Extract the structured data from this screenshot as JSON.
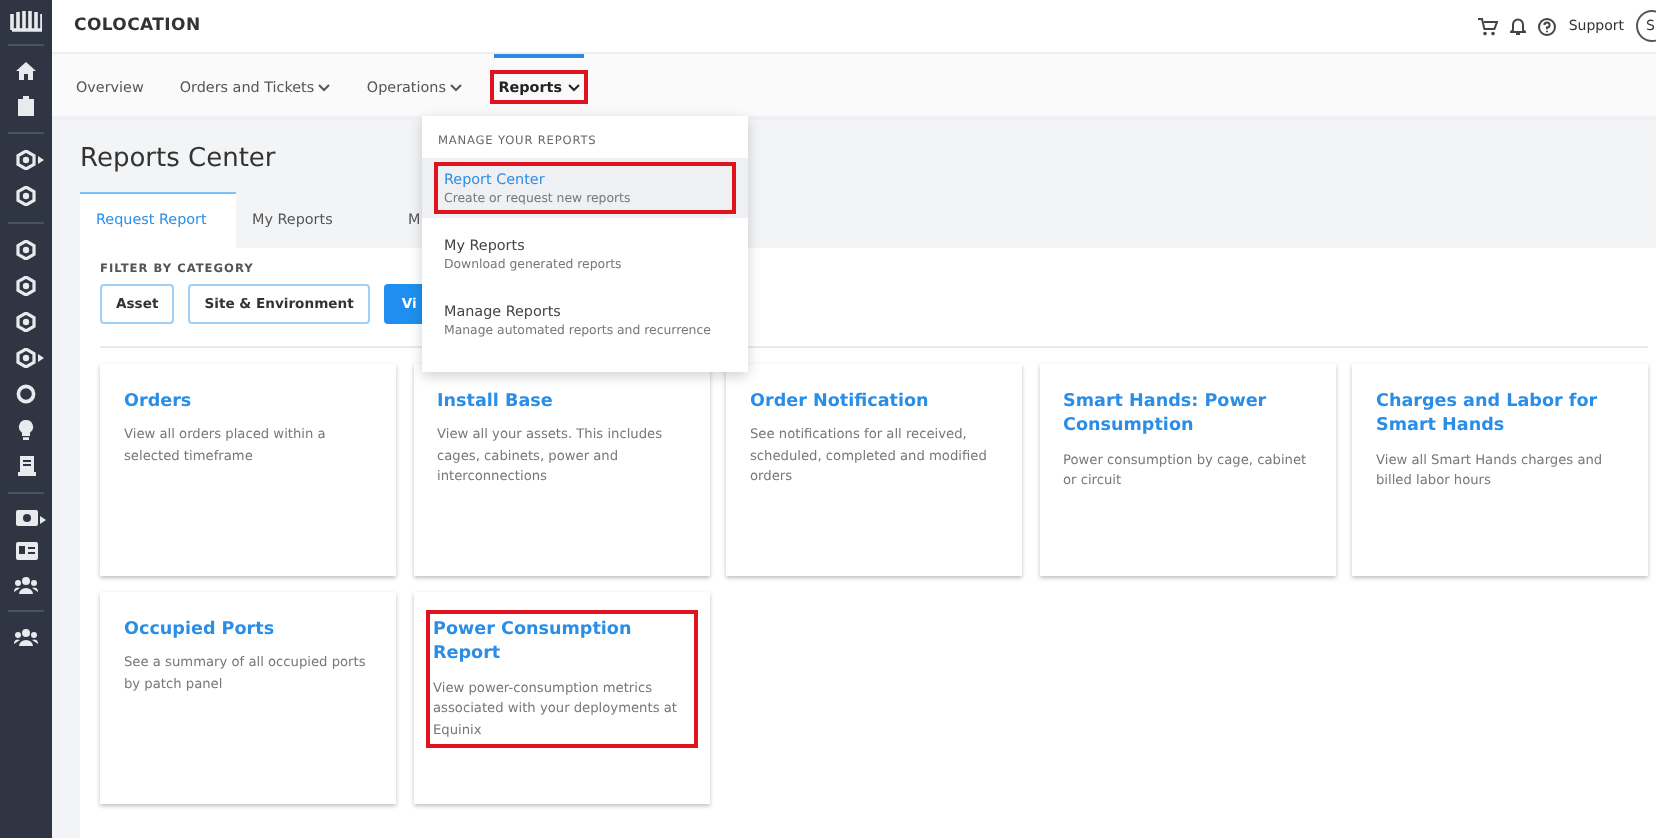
{
  "header": {
    "title": "COLOCATION",
    "support": "Support",
    "avatar": "S"
  },
  "nav": [
    {
      "label": "Overview",
      "dropdown": false,
      "selected": false,
      "highlighted": false
    },
    {
      "label": "Orders and Tickets",
      "dropdown": true,
      "selected": false,
      "highlighted": false
    },
    {
      "label": "Operations",
      "dropdown": true,
      "selected": false,
      "highlighted": false
    },
    {
      "label": "Reports",
      "dropdown": true,
      "selected": true,
      "highlighted": true
    }
  ],
  "menu": {
    "header": "MANAGE YOUR REPORTS",
    "items": [
      {
        "title": "Report Center",
        "subtitle": "Create or request new reports",
        "selected": true,
        "highlighted": true
      },
      {
        "title": "My Reports",
        "subtitle": "Download generated reports",
        "selected": false,
        "highlighted": false
      },
      {
        "title": "Manage Reports",
        "subtitle": "Manage automated reports and recurrence",
        "selected": false,
        "highlighted": false
      }
    ]
  },
  "page_title": "Reports Center",
  "tabs": [
    {
      "label": "Request Report",
      "selected": true
    },
    {
      "label": "My Reports",
      "selected": false
    },
    {
      "label": "M",
      "selected": false
    }
  ],
  "filter": {
    "label": "FILTER BY CATEGORY",
    "buttons": [
      {
        "label": "Asset",
        "selected": false
      },
      {
        "label": "Site & Environment",
        "selected": false
      },
      {
        "label": "Vi",
        "selected": true
      }
    ]
  },
  "cards": [
    {
      "title": "Orders",
      "description": "View all orders placed within a selected timeframe",
      "highlighted": false
    },
    {
      "title": "Install Base",
      "description": "View all your assets. This includes cages, cabinets, power and interconnections",
      "highlighted": false
    },
    {
      "title": "Order Notification",
      "description": "See notifications for all received, scheduled, completed and modified orders",
      "highlighted": false
    },
    {
      "title": "Smart Hands: Power Consumption",
      "description": "Power consumption by cage, cabinet or circuit",
      "highlighted": false
    },
    {
      "title": "Charges and Labor for Smart Hands",
      "description": "View all Smart Hands charges and billed labor hours",
      "highlighted": false
    },
    {
      "title": "Occupied Ports",
      "description": "See a summary of all occupied ports by patch panel",
      "highlighted": false
    },
    {
      "title": "Power Consumption Report",
      "description": "View power-consumption metrics associated with your deployments at Equinix",
      "highlighted": true
    }
  ]
}
